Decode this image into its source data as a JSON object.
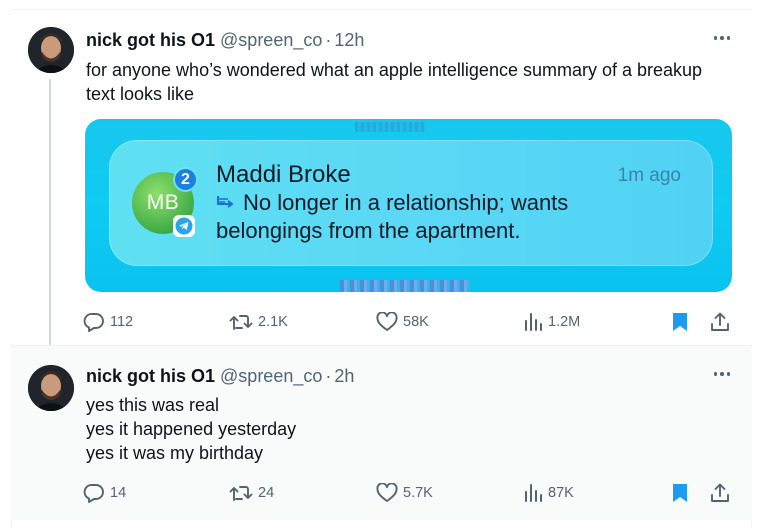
{
  "tweets": [
    {
      "author_name": "nick got his O1",
      "handle": "@spreen_co",
      "separator": "·",
      "time": "12h",
      "text_lines": [
        "for anyone who’s wondered what an apple intelligence summary of a breakup",
        "text looks like"
      ],
      "media": {
        "sender_initials": "MB",
        "badge_count": "2",
        "sender_name": "Maddi Broke",
        "timestamp": "1m ago",
        "summary_lines": [
          "No longer in a relationship; wants",
          "belongings from the apartment."
        ],
        "app_icon": "telegram-icon"
      },
      "stats": {
        "replies": "112",
        "retweets": "2.1K",
        "likes": "58K",
        "views": "1.2M"
      },
      "bookmarked": true
    },
    {
      "author_name": "nick got his O1",
      "handle": "@spreen_co",
      "separator": "·",
      "time": "2h",
      "text_lines": [
        "yes this was real",
        "yes it happened yesterday",
        "yes it was my birthday"
      ],
      "stats": {
        "replies": "14",
        "retweets": "24",
        "likes": "5.7K",
        "views": "87K"
      },
      "bookmarked": true
    }
  ],
  "colors": {
    "accent": "#1d9bf0",
    "bookmark_active": "#1d9bf0",
    "secondary_text": "#536471",
    "media_background": "#10c8f1"
  },
  "icons": [
    "more-icon",
    "reply-icon",
    "retweet-icon",
    "like-icon",
    "views-icon",
    "bookmark-icon",
    "share-icon",
    "summary-icon",
    "telegram-icon"
  ]
}
